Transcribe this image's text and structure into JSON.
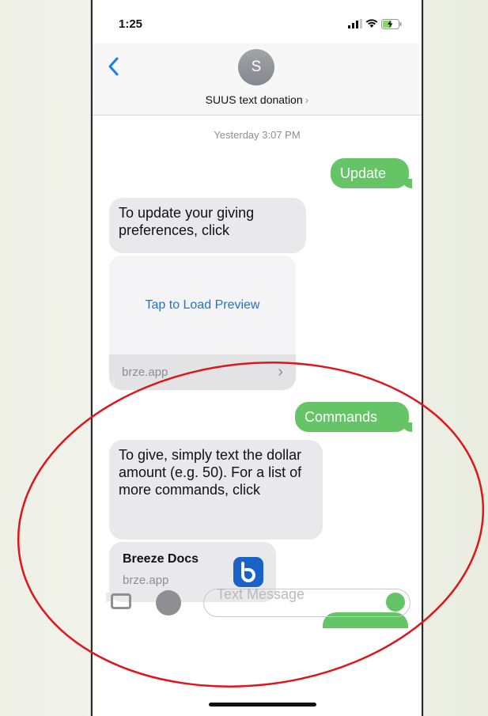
{
  "status": {
    "time": "1:25"
  },
  "header": {
    "avatar_letter": "S",
    "contact_name": "SUUS text donation",
    "chevron": "›"
  },
  "thread": {
    "timestamp": "Yesterday 3:07 PM",
    "messages": [
      {
        "from": "me",
        "text": "Update"
      },
      {
        "from": "them",
        "text": "To update your giving preferences, click"
      },
      {
        "from": "them",
        "type": "link-preview",
        "preview_text": "Tap to Load Preview",
        "domain": "brze.app",
        "chevron": "›"
      },
      {
        "from": "me",
        "text": "Commands"
      },
      {
        "from": "them",
        "text": "To give, simply text the dollar amount (e.g. 50). For a list of more commands, click"
      },
      {
        "from": "them",
        "type": "link-card",
        "title": "Breeze Docs",
        "domain": "brze.app",
        "icon": "breeze-b-icon"
      }
    ]
  },
  "composer": {
    "placeholder": "Text Message"
  },
  "colors": {
    "sent_bubble": "#65c466",
    "received_bubble": "#e9e9eb",
    "link_blue": "#1e73d8",
    "annotation_circle": "#e0151b"
  }
}
